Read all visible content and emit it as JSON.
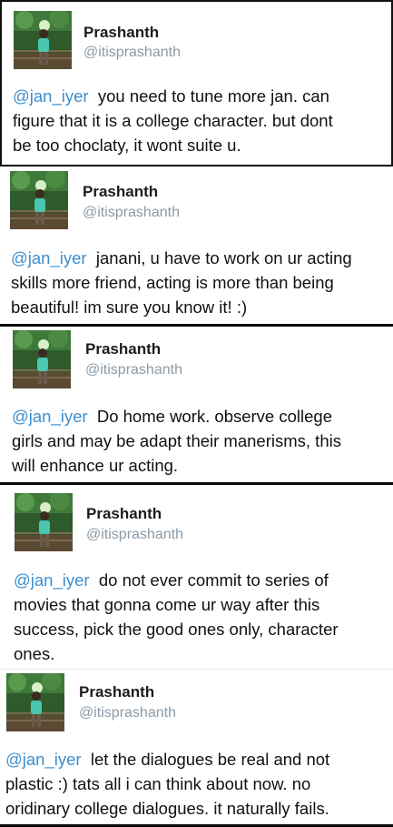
{
  "tweets": [
    {
      "name": "Prashanth",
      "handle": "@itisprashanth",
      "mention": "@jan_iyer",
      "lines": [
        "you need to tune more jan. can",
        "figure that it is a college character. but dont",
        "be too choclaty, it wont suite u."
      ]
    },
    {
      "name": "Prashanth",
      "handle": "@itisprashanth",
      "mention": "@jan_iyer",
      "lines": [
        "janani, u have to work on ur acting",
        "skills more friend, acting is more than being",
        "beautiful! im sure you know it! :)"
      ]
    },
    {
      "name": "Prashanth",
      "handle": "@itisprashanth",
      "mention": "@jan_iyer",
      "lines": [
        "Do home work. observe college",
        "girls and may be adapt their manerisms, this",
        "will enhance ur acting."
      ]
    },
    {
      "name": "Prashanth",
      "handle": "@itisprashanth",
      "mention": "@jan_iyer",
      "lines": [
        "do not ever commit to series of",
        "movies that gonna come ur way after this",
        "success, pick the good ones only, character",
        "ones."
      ]
    },
    {
      "name": "Prashanth",
      "handle": "@itisprashanth",
      "mention": "@jan_iyer",
      "lines": [
        "let the dialogues be real and not",
        "plastic  :) tats all i can think about now. no",
        "oridinary college dialogues. it naturally fails."
      ]
    }
  ]
}
